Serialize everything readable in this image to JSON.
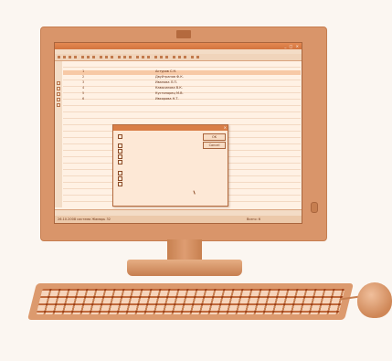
{
  "scene": {
    "description_colors": {
      "tint": "#d9956a",
      "background": "#fbf6f1"
    }
  },
  "window": {
    "title_buttons": "_ □ ×"
  },
  "table": {
    "rows": [
      {
        "num": "1",
        "name": "Астуров С.Н."
      },
      {
        "num": "2",
        "name": "Двуйтранов Ф.К."
      },
      {
        "num": "3",
        "name": "Иванова Л.П."
      },
      {
        "num": "4",
        "name": "Кавасилова В.К."
      },
      {
        "num": "5",
        "name": "Кустопорец М.В."
      },
      {
        "num": "6",
        "name": "Ивхорова Н.Т."
      }
    ]
  },
  "dialog": {
    "ok_label": "OK",
    "cancel_label": "Cancel"
  },
  "statusbar": {
    "left": "26.10.2008 система  Жамарь 32",
    "right": "Всего: 6"
  },
  "icons": [
    "window-close-icon",
    "toolbar-icons",
    "power-button-icon",
    "mouse-cursor-icon"
  ]
}
